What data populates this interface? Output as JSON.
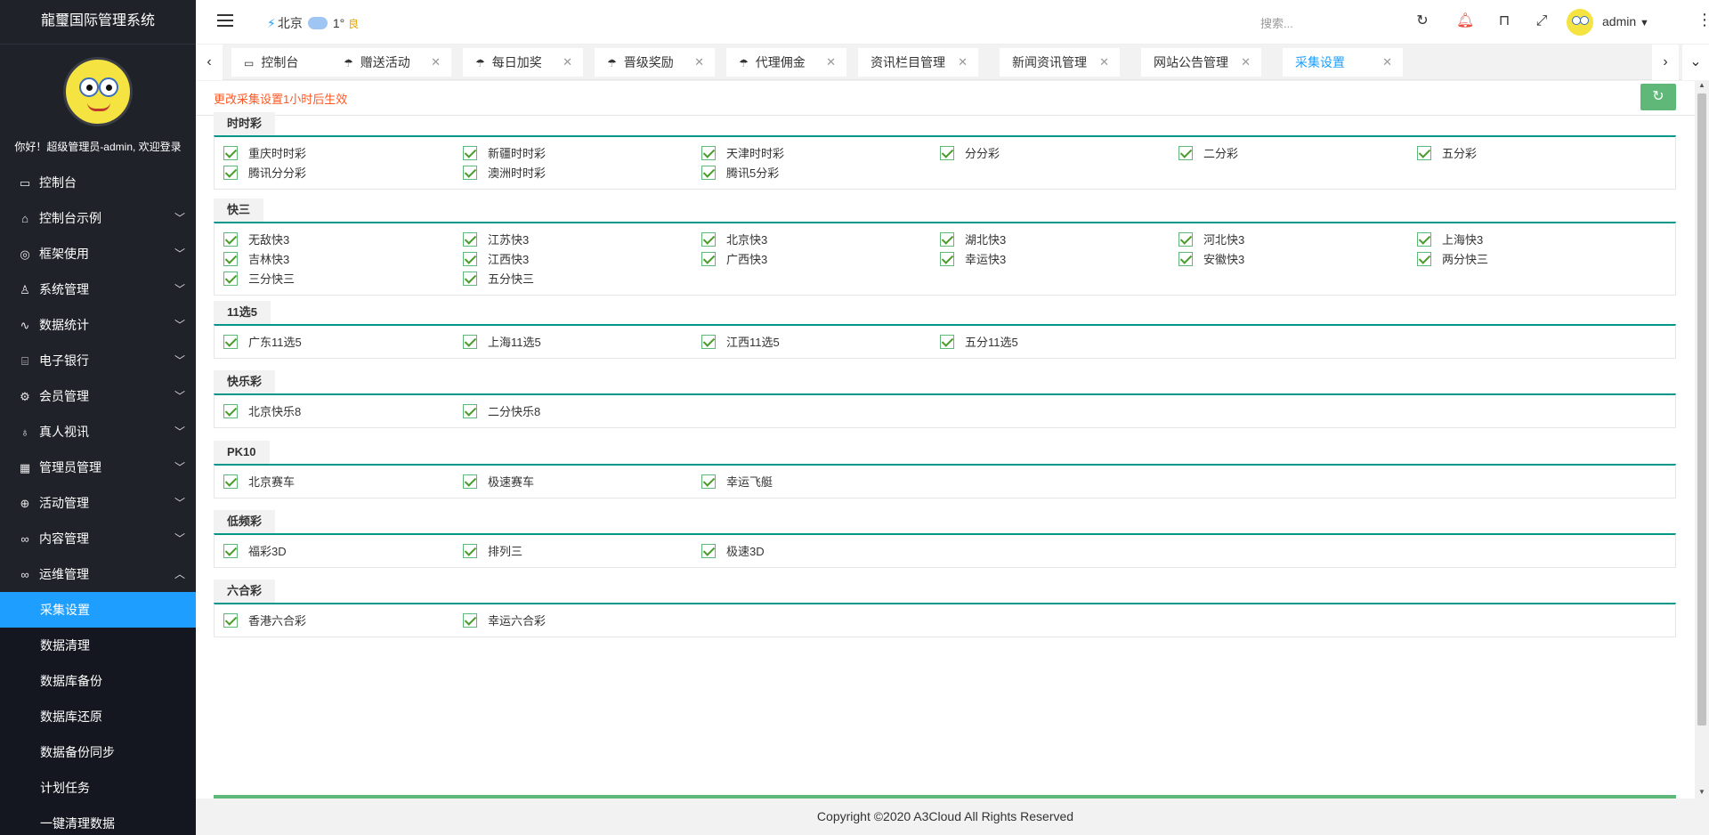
{
  "app": {
    "title": "龍璽国际管理系统",
    "welcome": "你好！超级管理员-admin, 欢迎登录"
  },
  "sidebar": {
    "items": [
      {
        "label": "控制台",
        "icon": "monitor-icon",
        "glyph": "▭",
        "has_arrow": false
      },
      {
        "label": "控制台示例",
        "icon": "home-icon",
        "glyph": "⌂",
        "has_arrow": true
      },
      {
        "label": "框架使用",
        "icon": "gauge-icon",
        "glyph": "◎",
        "has_arrow": true
      },
      {
        "label": "系统管理",
        "icon": "user-icon",
        "glyph": "♙",
        "has_arrow": true
      },
      {
        "label": "数据统计",
        "icon": "pulse-icon",
        "glyph": "∿",
        "has_arrow": true
      },
      {
        "label": "电子银行",
        "icon": "bank-icon",
        "glyph": "⌸",
        "has_arrow": true
      },
      {
        "label": "会员管理",
        "icon": "gear-icon",
        "glyph": "⚙",
        "has_arrow": true
      },
      {
        "label": "真人视讯",
        "icon": "video-icon",
        "glyph": "♁",
        "has_arrow": true
      },
      {
        "label": "管理员管理",
        "icon": "grid-icon",
        "glyph": "▦",
        "has_arrow": true
      },
      {
        "label": "活动管理",
        "icon": "add-circle-icon",
        "glyph": "⊕",
        "has_arrow": true
      },
      {
        "label": "内容管理",
        "icon": "link-icon",
        "glyph": "∞",
        "has_arrow": true
      },
      {
        "label": "运维管理",
        "icon": "link-icon",
        "glyph": "∞",
        "has_arrow": true,
        "expanded": true
      }
    ],
    "sub_items": [
      {
        "label": "采集设置",
        "active": true
      },
      {
        "label": "数据清理"
      },
      {
        "label": "数据库备份"
      },
      {
        "label": "数据库还原"
      },
      {
        "label": "数据备份同步"
      },
      {
        "label": "计划任务"
      },
      {
        "label": "一键清理数据"
      }
    ]
  },
  "header": {
    "weather": {
      "city": "北京",
      "temp": "1°",
      "air": "良"
    },
    "search_placeholder": "搜索...",
    "username": "admin"
  },
  "tabs": [
    {
      "label": "控制台",
      "icon": "monitor-icon",
      "glyph": "▭",
      "closable": false
    },
    {
      "label": "赠送活动",
      "icon": "umbrella-icon",
      "glyph": "☂",
      "closable": true
    },
    {
      "label": "每日加奖",
      "icon": "umbrella-icon",
      "glyph": "☂",
      "closable": true
    },
    {
      "label": "晋级奖励",
      "icon": "umbrella-icon",
      "glyph": "☂",
      "closable": true
    },
    {
      "label": "代理佣金",
      "icon": "umbrella-icon",
      "glyph": "☂",
      "closable": true
    },
    {
      "label": "资讯栏目管理",
      "closable": true
    },
    {
      "label": "新闻资讯管理",
      "closable": true
    },
    {
      "label": "网站公告管理",
      "closable": true
    },
    {
      "label": "采集设置",
      "closable": true,
      "active": true
    }
  ],
  "content": {
    "notice": "更改采集设置1小时后生效",
    "sections": [
      {
        "title": "时时彩",
        "items": [
          "重庆时时彩",
          "新疆时时彩",
          "天津时时彩",
          "分分彩",
          "二分彩",
          "五分彩",
          "腾讯分分彩",
          "澳洲时时彩",
          "腾讯5分彩"
        ]
      },
      {
        "title": "快三",
        "items": [
          "无敌快3",
          "江苏快3",
          "北京快3",
          "湖北快3",
          "河北快3",
          "上海快3",
          "吉林快3",
          "江西快3",
          "广西快3",
          "幸运快3",
          "安徽快3",
          "两分快三",
          "三分快三",
          "五分快三"
        ]
      },
      {
        "title": "11选5",
        "items": [
          "广东11选5",
          "上海11选5",
          "江西11选5",
          "五分11选5"
        ]
      },
      {
        "title": "快乐彩",
        "items": [
          "北京快乐8",
          "二分快乐8"
        ]
      },
      {
        "title": "PK10",
        "items": [
          "北京赛车",
          "极速赛车",
          "幸运飞艇"
        ]
      },
      {
        "title": "低频彩",
        "items": [
          "福彩3D",
          "排列三",
          "极速3D"
        ]
      },
      {
        "title": "六合彩",
        "items": [
          "香港六合彩",
          "幸运六合彩"
        ]
      }
    ]
  },
  "footer": {
    "copyright": "Copyright ©2020 A3Cloud All Rights Reserved"
  },
  "colors": {
    "accent": "#1e9fff",
    "sidebar_bg": "#20222a",
    "section_line": "#009688",
    "check": "#5fb878",
    "notice": "#ff5722"
  }
}
